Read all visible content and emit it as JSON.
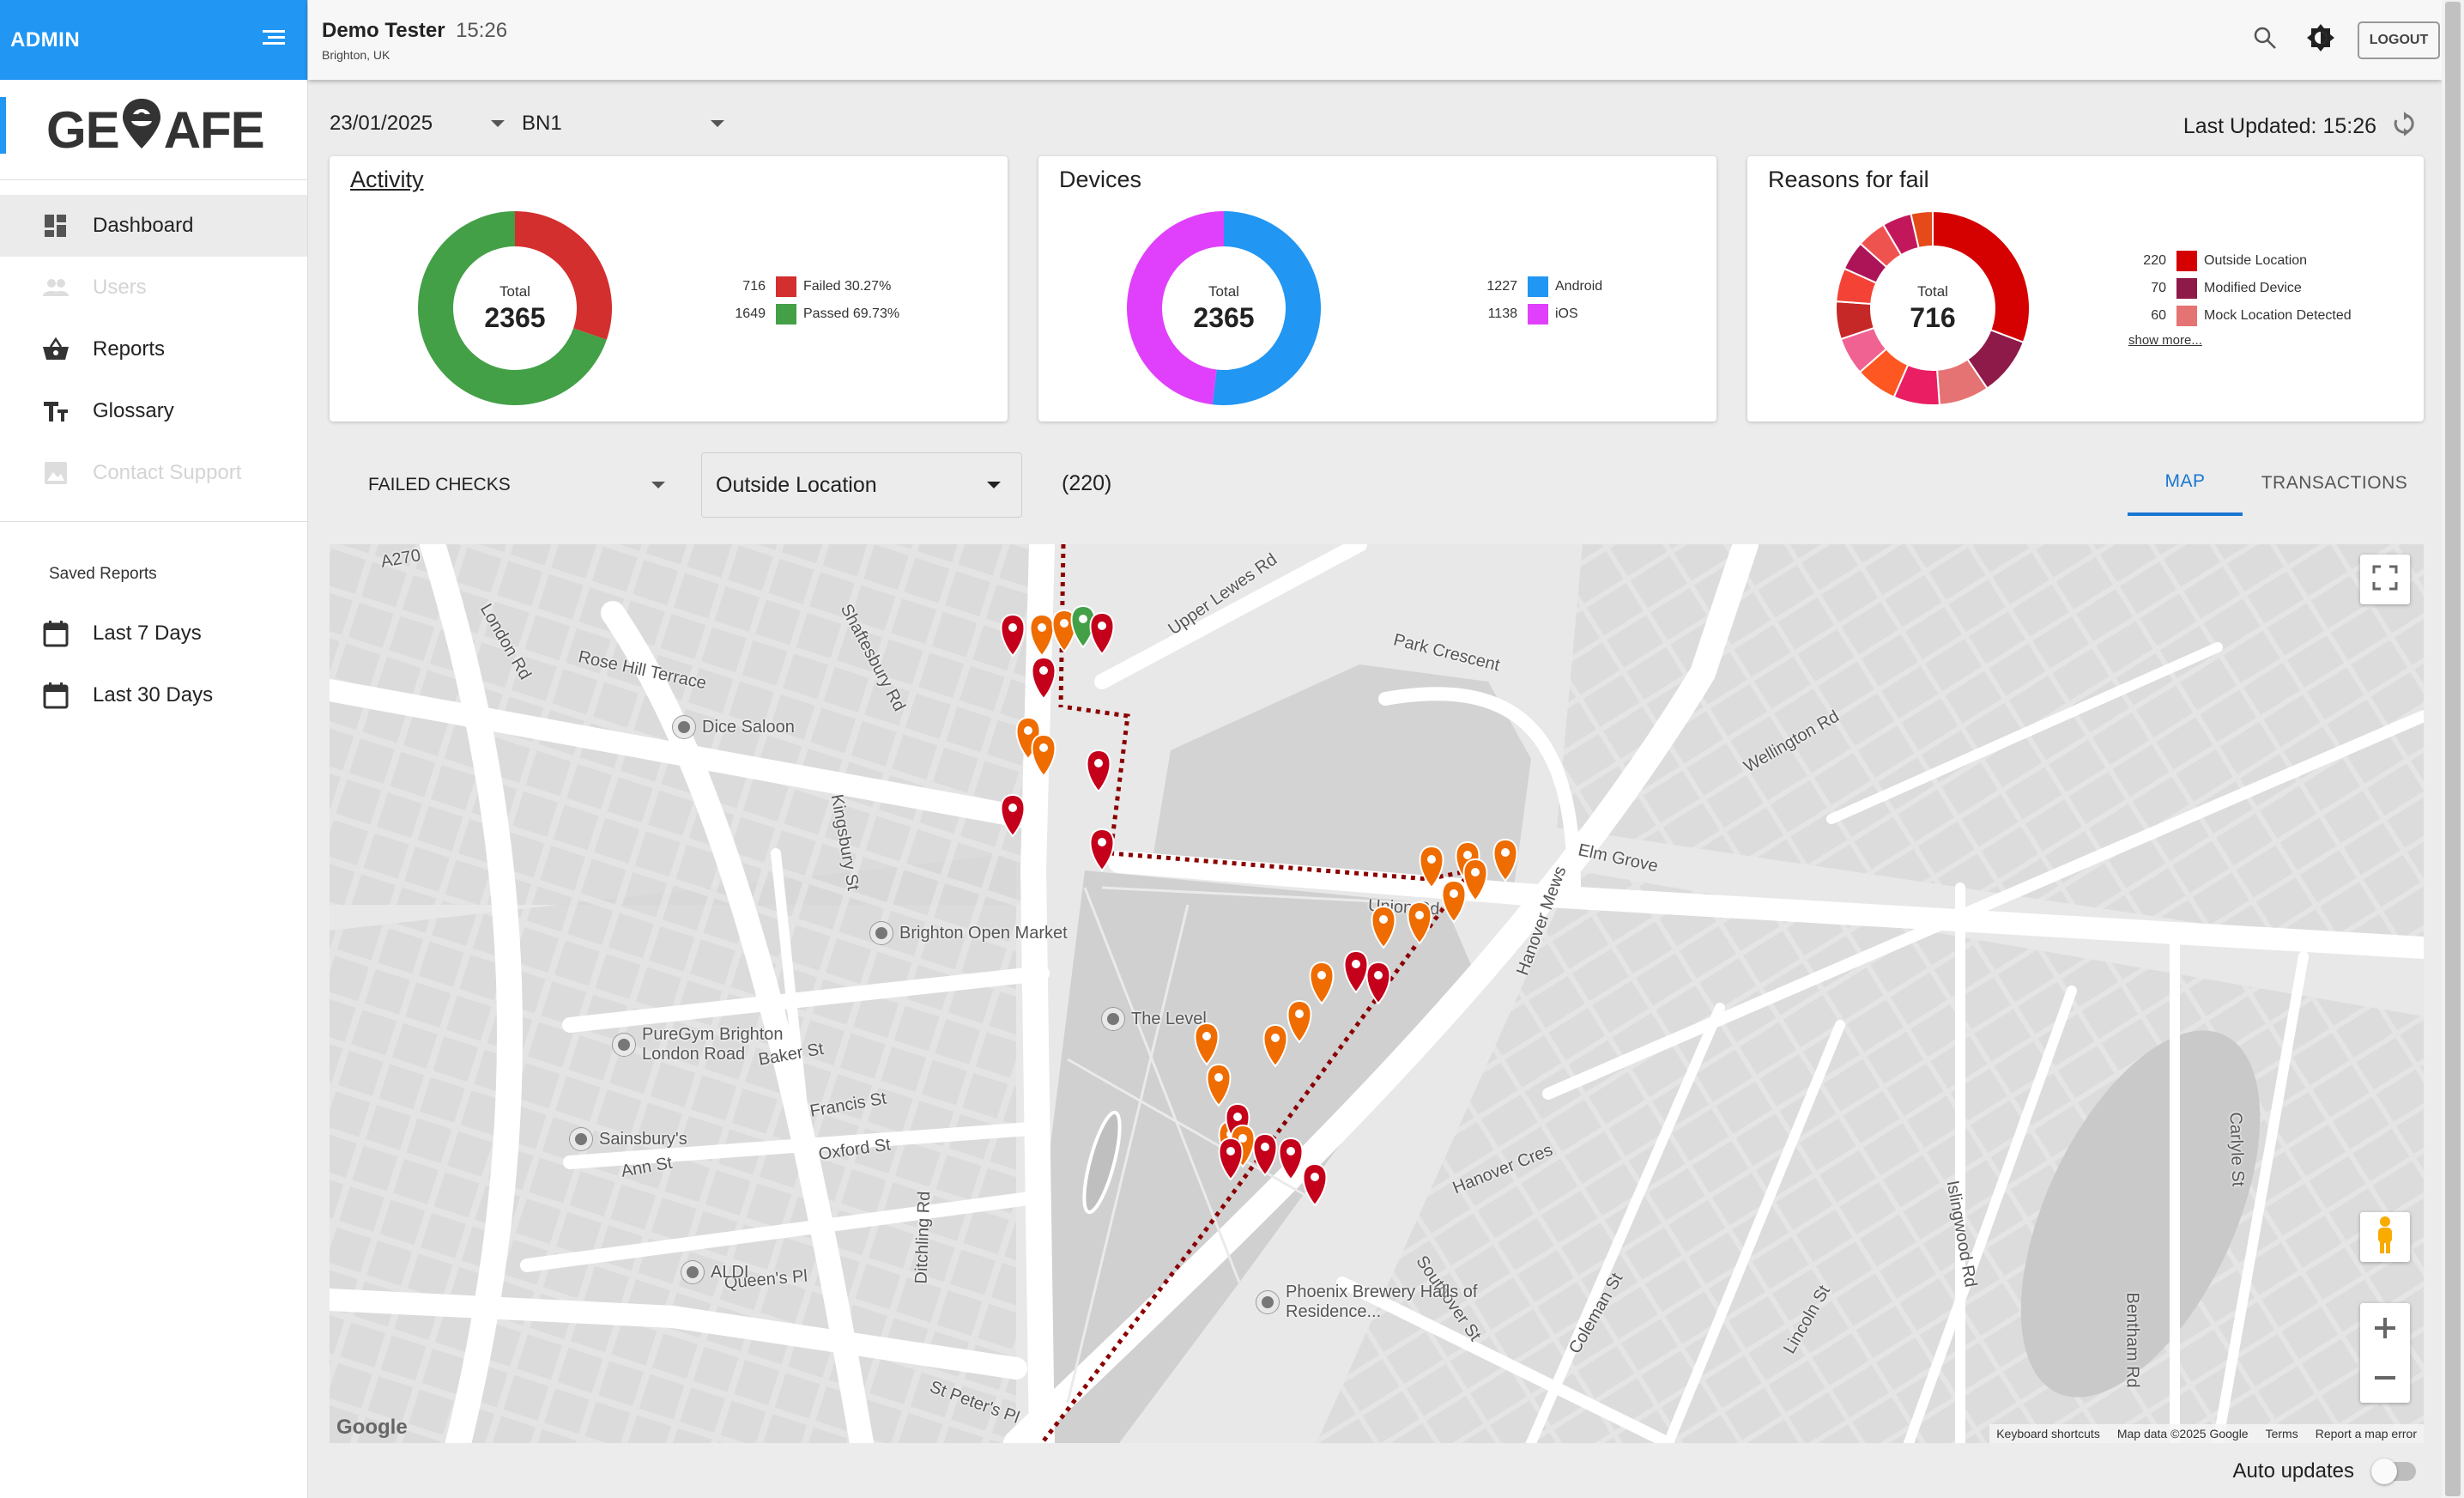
{
  "header": {
    "app_label": "ADMIN",
    "user_name": "Demo Tester",
    "time": "15:26",
    "location": "Brighton, UK",
    "logout_label": "LOGOUT"
  },
  "logo": {
    "text_before": "GE",
    "text_after": "AFE"
  },
  "nav": {
    "items": [
      {
        "label": "Dashboard",
        "icon": "dashboard-icon",
        "state": "active"
      },
      {
        "label": "Users",
        "icon": "users-icon",
        "state": "disabled"
      },
      {
        "label": "Reports",
        "icon": "basket-icon",
        "state": "normal"
      },
      {
        "label": "Glossary",
        "icon": "text-size-icon",
        "state": "normal"
      },
      {
        "label": "Contact Support",
        "icon": "image-icon",
        "state": "disabled"
      }
    ],
    "saved_title": "Saved Reports",
    "saved": [
      {
        "label": "Last 7 Days",
        "icon": "calendar-icon"
      },
      {
        "label": "Last 30 Days",
        "icon": "calendar-icon"
      }
    ]
  },
  "filters": {
    "date": "23/01/2025",
    "area": "BN1",
    "last_updated": "Last Updated: 15:26"
  },
  "cards": {
    "activity": {
      "title": "Activity",
      "total_label": "Total",
      "total": "2365",
      "legend": [
        {
          "count": "716",
          "label": "Failed 30.27%",
          "color": "#d32f2f"
        },
        {
          "count": "1649",
          "label": "Passed 69.73%",
          "color": "#43a047"
        }
      ]
    },
    "devices": {
      "title": "Devices",
      "total_label": "Total",
      "total": "2365",
      "legend": [
        {
          "count": "1227",
          "label": "Android",
          "color": "#2196f3"
        },
        {
          "count": "1138",
          "label": "iOS",
          "color": "#e040fb"
        }
      ]
    },
    "reasons": {
      "title": "Reasons for fail",
      "total_label": "Total",
      "total": "716",
      "legend": [
        {
          "count": "220",
          "label": "Outside Location",
          "color": "#d50000"
        },
        {
          "count": "70",
          "label": "Modified Device",
          "color": "#8e1a4a"
        },
        {
          "count": "60",
          "label": "Mock Location Detected",
          "color": "#e57373"
        }
      ],
      "show_more": "show more..."
    }
  },
  "chart_data": [
    {
      "type": "pie",
      "title": "Activity",
      "categories": [
        "Failed 30.27%",
        "Passed 69.73%"
      ],
      "values": [
        716,
        1649
      ],
      "colors": [
        "#d32f2f",
        "#43a047"
      ]
    },
    {
      "type": "pie",
      "title": "Devices",
      "categories": [
        "Android",
        "iOS"
      ],
      "values": [
        1227,
        1138
      ],
      "colors": [
        "#2196f3",
        "#e040fb"
      ]
    },
    {
      "type": "pie",
      "title": "Reasons for fail",
      "categories": [
        "Outside Location",
        "Modified Device",
        "Mock Location Detected",
        "",
        "",
        "",
        "",
        "",
        "",
        "",
        "",
        ""
      ],
      "values": [
        220,
        70,
        60,
        55,
        50,
        45,
        45,
        40,
        35,
        35,
        35,
        26
      ],
      "colors": [
        "#d50000",
        "#8e1a4a",
        "#e57373",
        "#e91e63",
        "#ff5722",
        "#f06292",
        "#c62828",
        "#f44336",
        "#ad1457",
        "#ef5350",
        "#c2185b",
        "#e64a19"
      ]
    }
  ],
  "checks": {
    "label": "FAILED CHECKS",
    "reason": "Outside Location",
    "count": "(220)"
  },
  "tabs": {
    "map": "MAP",
    "transactions": "TRANSACTIONS"
  },
  "map": {
    "streets": [
      "A270",
      "London Rd",
      "Rose Hill Terrace",
      "Shaftesbury Rd",
      "Park Crescent",
      "Upper Lewes Rd",
      "Elm Grove",
      "Union Rd",
      "Hanover Cres",
      "Baker St",
      "Francis St",
      "Oxford St",
      "Ann St",
      "Ditchling Rd",
      "Queen's Pl",
      "St Peter's Pl",
      "Kingsbury St",
      "Wellington Rd",
      "Islingwood Rd",
      "Hanover Mews",
      "Southover St",
      "Coleman St",
      "Lincoln St",
      "Bentham Rd",
      "Carlyle St"
    ],
    "places": [
      "Dice Saloon",
      "Brighton Open Market",
      "PureGym Brighton London Road",
      "Sainsbury's",
      "The Level",
      "ALDI",
      "Phoenix Brewery Halls of Residence..."
    ],
    "google": "Google",
    "attribution": [
      "Keyboard shortcuts",
      "Map data ©2025 Google",
      "Terms",
      "Report a map error"
    ]
  },
  "footer": {
    "auto_updates": "Auto updates"
  }
}
